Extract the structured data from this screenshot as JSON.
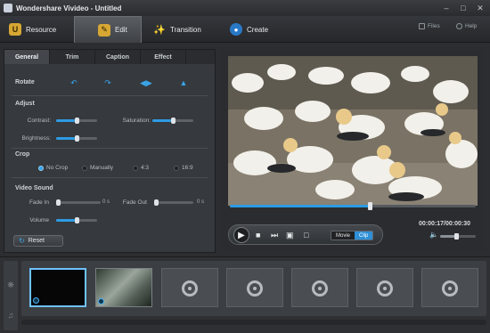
{
  "window": {
    "title": "Wondershare Vivideo - Untitled"
  },
  "toolbar": {
    "resource": "Resource",
    "edit": "Edit",
    "transition": "Transition",
    "create": "Create",
    "files": "Files",
    "help": "Help"
  },
  "edit_panel": {
    "tabs": [
      "General",
      "Trim",
      "Caption",
      "Effect"
    ],
    "active_tab": "General",
    "rotate_label": "Rotate",
    "adjust_label": "Adjust",
    "contrast_label": "Contrast:",
    "saturation_label": "Saturation:",
    "brightness_label": "Brightness:",
    "contrast_level": 0.5,
    "saturation_level": 0.5,
    "brightness_level": 0.5,
    "crop_label": "Crop",
    "crop_options": [
      "No Crop",
      "Manually",
      "4:3",
      "16:9"
    ],
    "crop_selected": "No Crop",
    "video_sound_label": "Video Sound",
    "fade_in_label": "Fade In",
    "fade_in_value": "0 s",
    "fade_out_label": "Fade Out",
    "fade_out_value": "0 s",
    "volume_label": "Volume",
    "volume_level": 0.5,
    "reset_label": "Reset"
  },
  "player": {
    "timecode": "00:00:17/00:00:30",
    "progress": 0.57,
    "mode_movie": "Movie",
    "mode_clip": "Clip",
    "mode_selected": "Clip",
    "volume_level": 0.45
  },
  "storyboard": {
    "clip_count": 9
  },
  "colors": {
    "accent": "#2d9be3",
    "toolbar_icon_gold": "#d6a733"
  }
}
